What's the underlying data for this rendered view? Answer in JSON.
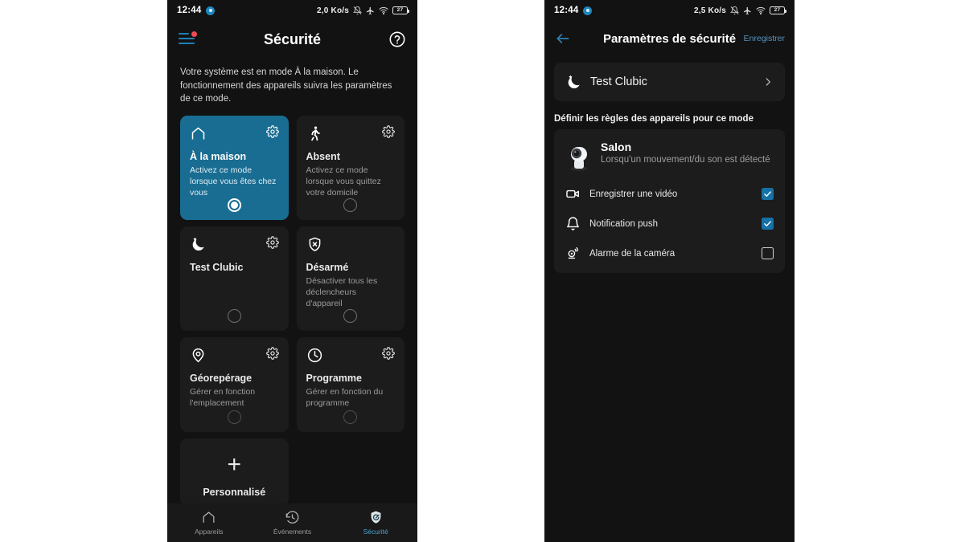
{
  "theme": {
    "accent": "#1a6d92",
    "checkbox": "#1571a6",
    "nav_active": "#4aa3d8",
    "card_bg": "#1c1c1c",
    "screen_bg": "#121212",
    "badge": "#ef4a55"
  },
  "left_phone": {
    "statusbar": {
      "time": "12:44",
      "network_speed": "2,0 Ko/s",
      "battery_level": "27",
      "icons": [
        "bell-muted-icon",
        "airplane-mode-icon",
        "wifi-icon",
        "battery-icon"
      ]
    },
    "appbar": {
      "menu_icon": "hamburger-menu-icon",
      "title": "Sécurité",
      "help_icon": "help-circle-icon"
    },
    "intro": "Votre système est en mode À la maison. Le fonctionnement des appareils suivra les paramètres de ce mode.",
    "modes": [
      {
        "icon": "home-icon",
        "name": "À la maison",
        "desc": "Activez ce mode lorsque vous êtes chez vous",
        "selected": true,
        "has_gear": true,
        "gear": "gear-icon"
      },
      {
        "icon": "walk-icon",
        "name": "Absent",
        "desc": "Activez ce mode lorsque vous quittez votre domicile",
        "selected": false,
        "has_gear": true,
        "gear": "gear-icon"
      },
      {
        "icon": "moon-icon",
        "name": "Test Clubic",
        "desc": "",
        "selected": false,
        "has_gear": true,
        "gear": "gear-icon"
      },
      {
        "icon": "shield-x-icon",
        "name": "Désarmé",
        "desc": "Désactiver tous les déclencheurs d'appareil",
        "selected": false,
        "has_gear": false,
        "gear": ""
      },
      {
        "icon": "pin-icon",
        "name": "Géorepérage",
        "desc": "Gérer en fonction l'emplacement",
        "selected": false,
        "has_gear": true,
        "gear": "gear-icon"
      },
      {
        "icon": "clock-icon",
        "name": "Programme",
        "desc": "Gérer en fonction du programme",
        "selected": false,
        "has_gear": true,
        "gear": "gear-icon"
      }
    ],
    "add_card": {
      "icon": "plus-icon",
      "label": "Personnalisé"
    },
    "bottomnav": [
      {
        "icon": "home-outline-icon",
        "label": "Appareils",
        "active": false
      },
      {
        "icon": "history-icon",
        "label": "Événements",
        "active": false
      },
      {
        "icon": "shield-check-icon",
        "label": "Sécurité",
        "active": true
      }
    ]
  },
  "right_phone": {
    "statusbar": {
      "time": "12:44",
      "network_speed": "2,5 Ko/s",
      "battery_level": "27",
      "icons": [
        "bell-muted-icon",
        "airplane-mode-icon",
        "wifi-icon",
        "battery-icon"
      ]
    },
    "appbar": {
      "back_icon": "arrow-left-icon",
      "title": "Paramètres de sécurité",
      "save_label": "Enregistrer"
    },
    "mode_row": {
      "icon": "moon-icon",
      "name": "Test Clubic",
      "chevron": "chevron-right-icon"
    },
    "section_title": "Définir les règles des appareils pour ce mode",
    "device": {
      "thumb": "camera-thumbnail",
      "name": "Salon",
      "trigger": "Lorsqu'un mouvement/du son est détecté"
    },
    "rules": [
      {
        "icon": "video-camera-icon",
        "label": "Enregistrer une vidéo",
        "checked": true
      },
      {
        "icon": "bell-icon",
        "label": "Notification push",
        "checked": true
      },
      {
        "icon": "siren-icon",
        "label": "Alarme de la caméra",
        "checked": false
      }
    ]
  }
}
